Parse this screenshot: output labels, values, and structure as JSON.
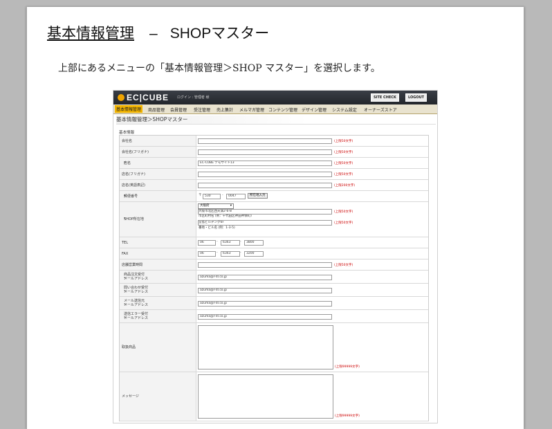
{
  "doc": {
    "title": "基本情報管理",
    "title_dash": "–",
    "title_rest": "SHOPマスター",
    "desc": "上部にあるメニューの「基本情報管理＞SHOP マスター」を選択します。"
  },
  "app": {
    "logo": "EC|CUBE",
    "login_text": "ログイン : 管理者 様",
    "site_check": "SITE CHECK",
    "logout": "LOGOUT",
    "nav": [
      "基本情報管理",
      "商品管理",
      "会員管理",
      "受注管理",
      "売上集計",
      "メルマガ管理",
      "コンテンツ管理",
      "デザイン管理",
      "システム設定",
      "オーナーズストア"
    ],
    "breadcrumb": "基本情報管理＞SHOPマスター",
    "section": "基本情報"
  },
  "form": {
    "company_name": "会社名",
    "company_kana": "会社名(フリガナ)",
    "shop_name": "店名",
    "shop_name_value": "EC-CUBE デモサイト13",
    "shop_kana": "店名(フリガナ)",
    "shop_en": "店名(英語表記)",
    "zip": "郵便番号",
    "zip_mark": "〒",
    "zip1": "530",
    "zip2": "0047",
    "zip_btn": "所在地入力",
    "address": "SHOP所在地",
    "pref": "大阪府",
    "addr1": "大阪市北区西天満2-6-8",
    "addr1_note": "市区町村名 (例：千代田区神田神保町)",
    "addr2": "堂島ビルヂング6F",
    "addr2_note": "番地・ビル名 (例：1-3-5)",
    "tel": "TEL",
    "tel1": "06",
    "tel2": "6363",
    "tel3": "3800",
    "fax": "FAX",
    "fax1": "06",
    "fax2": "6363",
    "fax3": "3200",
    "hours": "店舗営業時間",
    "order_email_1": "商品注文受付",
    "order_email_2": "メールアドレス",
    "inquiry_email_1": "問い合わせ受付",
    "inquiry_email_2": "メールアドレス",
    "sender_email_1": "メール送信元",
    "sender_email_2": "メールアドレス",
    "error_email_1": "送信エラー受付",
    "error_email_2": "メールアドレス",
    "email_value": "azuma@r-dl.co.jp",
    "products": "取扱商品",
    "message": "メッセージ",
    "hint_50": "(上限50文字)",
    "hint_200": "(上限200文字)",
    "hint_99999": "(上限99999文字)",
    "req_mark": "*",
    "dash": "-"
  },
  "colors": {
    "header_dark": "#2a2d33",
    "nav_active": "#f2b400",
    "required": "#cc0000"
  }
}
